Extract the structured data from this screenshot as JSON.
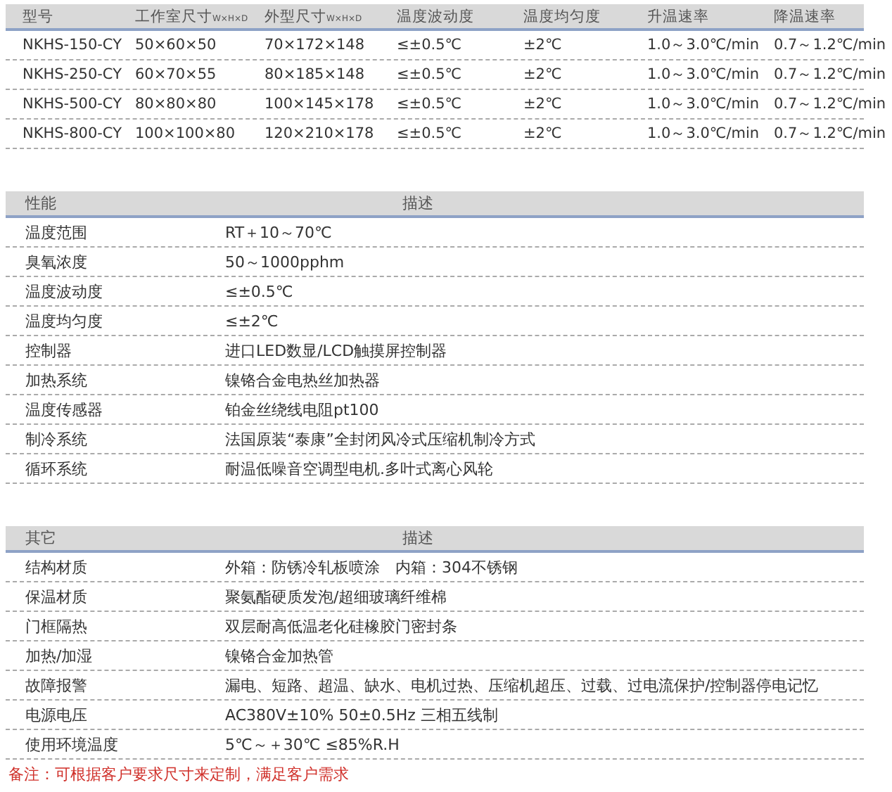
{
  "models_table": {
    "columns": [
      "型号",
      "工作室尺寸$_{W×H×D}$",
      "外型尺寸$_{W×H×D}$",
      "温度波动度",
      "温度均匀度",
      "升温速率",
      "降温速率"
    ],
    "rows": [
      [
        "NKHS-150-CY",
        "50×60×50",
        "70×172×148",
        "≤±0.5℃",
        "±2℃",
        "1.0～3.0℃/min",
        "0.7～1.2℃/min"
      ],
      [
        "NKHS-250-CY",
        "60×70×55",
        "80×185×148",
        "≤±0.5℃",
        "±2℃",
        "1.0～3.0℃/min",
        "0.7～1.2℃/min"
      ],
      [
        "NKHS-500-CY",
        "80×80×80",
        "100×145×178",
        "≤±0.5℃",
        "±2℃",
        "1.0～3.0℃/min",
        "0.7～1.2℃/min"
      ],
      [
        "NKHS-800-CY",
        "100×100×80",
        "120×210×178",
        "≤±0.5℃",
        "±2℃",
        "1.0～3.0℃/min",
        "0.7～1.2℃/min"
      ]
    ]
  },
  "performance_table": {
    "columns": [
      "性能",
      "描述"
    ],
    "rows": [
      [
        "温度范围",
        "RT＋10～70℃"
      ],
      [
        "臭氧浓度",
        "50～1000pphm"
      ],
      [
        "温度波动度",
        "≤±0.5℃"
      ],
      [
        "温度均匀度",
        "≤±2℃"
      ],
      [
        "控制器",
        "进口LED数显/LCD触摸屏控制器"
      ],
      [
        "加热系统",
        "镍铬合金电热丝加热器"
      ],
      [
        "温度传感器",
        "铂金丝绕线电阻pt100"
      ],
      [
        "制冷系统",
        "法国原装“泰康”全封闭风冷式压缩机制冷方式"
      ],
      [
        "循环系统",
        "耐温低噪音空调型电机.多叶式离心风轮"
      ]
    ]
  },
  "other_table": {
    "columns": [
      "其它",
      "描述"
    ],
    "rows": [
      [
        "结构材质",
        "外箱：防锈冷轧板喷涂　内箱：304不锈钢"
      ],
      [
        "保温材质",
        "聚氨酯硬质发泡/超细玻璃纤维棉"
      ],
      [
        "门框隔热",
        "双层耐高低温老化硅橡胶门密封条"
      ],
      [
        "加热/加湿",
        "镍铬合金加热管"
      ],
      [
        "故障报警",
        "漏电、短路、超温、缺水、电机过热、压缩机超压、过载、过电流保护/控制器停电记忆"
      ],
      [
        "电源电压",
        "AC380V±10% 50±0.5Hz 三相五线制"
      ],
      [
        "使用环境温度",
        "5℃～＋30℃ ≤85%R.H"
      ]
    ]
  },
  "note": "备注：可根据客户要求尺寸来定制，满足客户需求"
}
